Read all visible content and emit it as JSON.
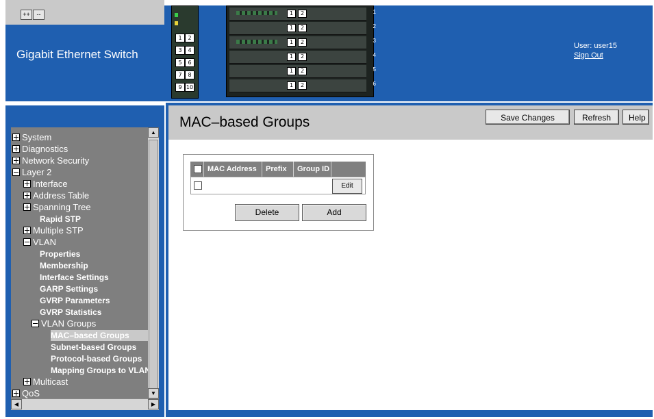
{
  "header": {
    "brand": "Gigabit Ethernet Switch",
    "user_label": "User: user15",
    "signout_label": "Sign Out",
    "small_device_ports": [
      "1",
      "2",
      "3",
      "4",
      "5",
      "6",
      "7",
      "8",
      "9",
      "10"
    ],
    "large_device_ports": [
      "1",
      "2"
    ],
    "large_device_bays": [
      "1",
      "2",
      "3",
      "4",
      "5",
      "6"
    ]
  },
  "sidebar": {
    "expand_all": "++",
    "collapse_all": "--",
    "tree": [
      {
        "label": "System",
        "type": "plus"
      },
      {
        "label": "Diagnostics",
        "type": "plus"
      },
      {
        "label": "Network Security",
        "type": "plus"
      },
      {
        "label": "Layer 2",
        "type": "minus"
      },
      {
        "label": "Interface",
        "type": "plus"
      },
      {
        "label": "Address Table",
        "type": "plus"
      },
      {
        "label": "Spanning Tree",
        "type": "plus"
      },
      {
        "label": "Rapid STP",
        "type": "leaf"
      },
      {
        "label": "Multiple STP",
        "type": "plus"
      },
      {
        "label": "VLAN",
        "type": "minus"
      },
      {
        "label": "Properties",
        "type": "leaf"
      },
      {
        "label": "Membership",
        "type": "leaf"
      },
      {
        "label": "Interface Settings",
        "type": "leaf"
      },
      {
        "label": "GARP Settings",
        "type": "leaf"
      },
      {
        "label": "GVRP Parameters",
        "type": "leaf"
      },
      {
        "label": "GVRP Statistics",
        "type": "leaf"
      },
      {
        "label": "VLAN Groups",
        "type": "minus"
      },
      {
        "label": "MAC–based Groups",
        "type": "leaf",
        "selected": true
      },
      {
        "label": "Subnet-based Groups",
        "type": "leaf"
      },
      {
        "label": "Protocol-based Groups",
        "type": "leaf"
      },
      {
        "label": "Mapping Groups to VLAN",
        "type": "leaf"
      },
      {
        "label": "Multicast",
        "type": "plus"
      },
      {
        "label": "QoS",
        "type": "plus"
      }
    ]
  },
  "main": {
    "title": "MAC–based Groups",
    "toolbar": {
      "save": "Save Changes",
      "refresh": "Refresh",
      "help": "Help"
    },
    "table": {
      "columns": [
        "MAC Address",
        "Prefix",
        "Group ID"
      ],
      "edit_label": "Edit"
    },
    "delete_label": "Delete",
    "add_label": "Add"
  },
  "colors": {
    "frame": "#1f5fb0",
    "tree_bg": "#7f7f7f",
    "bar_bg": "#c9c9c9"
  }
}
